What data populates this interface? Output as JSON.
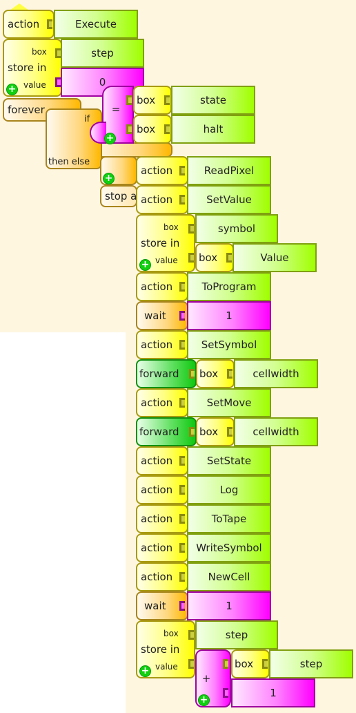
{
  "canvas": {
    "background_color": "#fff6e0",
    "colors": {
      "action_block": "#ffff00",
      "flow_block": "#ffb800",
      "turtle_block": "#10c810",
      "number_block": "#ff00ff",
      "text_arg": "#a0ff00",
      "add_icon": "#10d010"
    }
  },
  "blocks": {
    "start": {
      "label": "action",
      "name": "Execute"
    },
    "store1": {
      "label": "store in",
      "box_label": "box",
      "value_label": "value",
      "box_name": "step",
      "value": "0"
    },
    "forever": {
      "label": "forever"
    },
    "ifelse": {
      "if_label": "if",
      "then_else_label": "then else"
    },
    "equals": {
      "op": "=",
      "left_label": "box",
      "left_name": "state",
      "right_label": "box",
      "right_name": "halt"
    },
    "stop": {
      "label": "stop a"
    },
    "stack": [
      {
        "type": "action",
        "label": "action",
        "arg": "ReadPixel"
      },
      {
        "type": "action",
        "label": "action",
        "arg": "SetValue"
      },
      {
        "type": "store",
        "label": "store in",
        "box_label": "box",
        "value_label": "value",
        "box_name": "symbol",
        "value_box_label": "box",
        "value_box_name": "Value"
      },
      {
        "type": "action",
        "label": "action",
        "arg": "ToProgram"
      },
      {
        "type": "wait",
        "label": "wait",
        "arg": "1"
      },
      {
        "type": "action",
        "label": "action",
        "arg": "SetSymbol"
      },
      {
        "type": "forward",
        "label": "forward",
        "box_label": "box",
        "arg": "cellwidth"
      },
      {
        "type": "action",
        "label": "action",
        "arg": "SetMove"
      },
      {
        "type": "forward",
        "label": "forward",
        "box_label": "box",
        "arg": "cellwidth"
      },
      {
        "type": "action",
        "label": "action",
        "arg": "SetState"
      },
      {
        "type": "action",
        "label": "action",
        "arg": "Log"
      },
      {
        "type": "action",
        "label": "action",
        "arg": "ToTape"
      },
      {
        "type": "action",
        "label": "action",
        "arg": "WriteSymbol"
      },
      {
        "type": "action",
        "label": "action",
        "arg": "NewCell"
      },
      {
        "type": "wait",
        "label": "wait",
        "arg": "1"
      },
      {
        "type": "store",
        "label": "store in",
        "box_label": "box",
        "value_label": "value",
        "box_name": "step",
        "plus": {
          "op": "+",
          "box_label": "box",
          "box_name": "step",
          "addend": "1"
        }
      }
    ]
  }
}
